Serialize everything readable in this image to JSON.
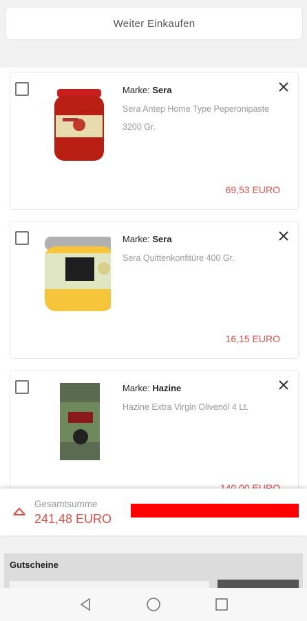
{
  "header": {
    "continue_label": "Weiter Einkaufen"
  },
  "cart": {
    "brand_prefix": "Marke:",
    "items": [
      {
        "brand": "Sera",
        "title": "Sera Antep Home Type Peperonipaste 3200 Gr.",
        "price": "69,53 EURO",
        "image": "red-pepper-paste-jar"
      },
      {
        "brand": "Sera",
        "title": "Sera Quittenkonfitüre 400 Gr.",
        "price": "16,15 EURO",
        "image": "quince-jam-jar"
      },
      {
        "brand": "Hazine",
        "title": "Hazine Extra Virgin Olivenöl 4 Lt.",
        "price": "140,00 EURO",
        "image": "olive-oil-tin"
      }
    ]
  },
  "summary": {
    "label": "Gesamtsumme",
    "total": "241,48 EURO",
    "icon": "chevron-up-icon"
  },
  "vouchers": {
    "title": "Gutscheine"
  },
  "colors": {
    "accent": "#e0504a",
    "checkout": "#ff0000"
  }
}
